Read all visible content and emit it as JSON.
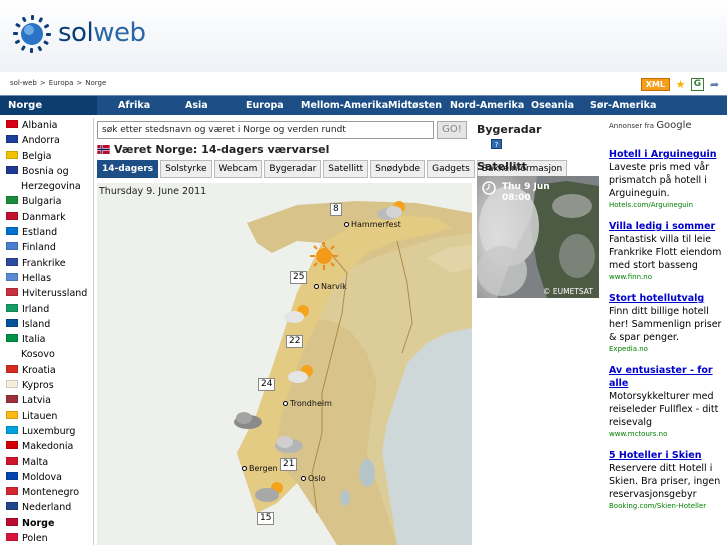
{
  "header": {
    "logo_sol": "sol",
    "logo_web": "web"
  },
  "breadcrumb": [
    "sol-web",
    ">",
    "Europa",
    ">",
    "Norge"
  ],
  "toolbar": {
    "xml_label": "XML"
  },
  "nav": {
    "current": "Norge",
    "items": [
      "Afrika",
      "Asia",
      "Europa",
      "Mellom-Amerika",
      "Midtøsten",
      "Nord-Amerika",
      "Oseania",
      "Sør-Amerika"
    ]
  },
  "sidebar": {
    "countries": [
      {
        "name": "Albania",
        "flag": "#d90012"
      },
      {
        "name": "Andorra",
        "flag": "#1e3f99"
      },
      {
        "name": "Belgia",
        "flag": "#f2c200"
      },
      {
        "name": "Bosnia og",
        "flag": "#1f3a93"
      },
      {
        "name": "Herzegovina",
        "flag": ""
      },
      {
        "name": "Bulgaria",
        "flag": "#1c8a3c"
      },
      {
        "name": "Danmark",
        "flag": "#c8102e"
      },
      {
        "name": "Estland",
        "flag": "#0072ce"
      },
      {
        "name": "Finland",
        "flag": "#4a7fcf"
      },
      {
        "name": "Frankrike",
        "flag": "#2c4ba0"
      },
      {
        "name": "Hellas",
        "flag": "#5a8ad6"
      },
      {
        "name": "Hviterussland",
        "flag": "#c8313e"
      },
      {
        "name": "Irland",
        "flag": "#169b62"
      },
      {
        "name": "Island",
        "flag": "#02529c"
      },
      {
        "name": "Italia",
        "flag": "#009246"
      },
      {
        "name": "Kosovo",
        "flag": ""
      },
      {
        "name": "Kroatia",
        "flag": "#d52b1e"
      },
      {
        "name": "Kypros",
        "flag": "#f5efdc"
      },
      {
        "name": "Latvia",
        "flag": "#9e3039"
      },
      {
        "name": "Litauen",
        "flag": "#fdb913"
      },
      {
        "name": "Luxemburg",
        "flag": "#00a1de"
      },
      {
        "name": "Makedonia",
        "flag": "#d20000"
      },
      {
        "name": "Malta",
        "flag": "#cf142b"
      },
      {
        "name": "Moldova",
        "flag": "#0046ae"
      },
      {
        "name": "Montenegro",
        "flag": "#d3272f"
      },
      {
        "name": "Nederland",
        "flag": "#21468b"
      },
      {
        "name": "Norge",
        "flag": "#ba0c2f"
      },
      {
        "name": "Polen",
        "flag": "#dc143c"
      }
    ],
    "current": "Norge"
  },
  "search": {
    "value": "søk etter stedsnavn og været i Norge og verden rundt",
    "button": "GO!"
  },
  "page_title": "Været Norge: 14-dagers værvarsel",
  "tabs": [
    "14-dagers",
    "Solstyrke",
    "Webcam",
    "Bygeradar",
    "Satellitt",
    "Snødybde",
    "Gadgets",
    "Bakkeinformasjon"
  ],
  "map": {
    "date": "Thursday  9. June 2011",
    "temps": [
      "8",
      "25",
      "22",
      "24",
      "21",
      "15"
    ],
    "cities": [
      "Hammerfest",
      "Narvik",
      "Trondheim",
      "Bergen",
      "Oslo"
    ]
  },
  "radar": {
    "title": "Bygeradar",
    "help": "?",
    "sat_title": "Satellitt",
    "sat_date_line1": "Thu  9 Jun",
    "sat_date_line2": "08:00",
    "sat_credit": "© EUMETSAT"
  },
  "ads": {
    "label": "Annonser fra",
    "label_brand": "Google",
    "items": [
      {
        "title": "Hotell i Arguineguin",
        "body": "Laveste pris med vår prismatch på hotell i Arguineguin.",
        "url": "Hotels.com/Arguineguin"
      },
      {
        "title": "Villa ledig i sommer",
        "body": "Fantastisk villa til leie Frankrike Flott eiendom med stort basseng",
        "url": "www.finn.no"
      },
      {
        "title": "Stort hotellutvalg",
        "body": "Finn ditt billige hotell her! Sammenlign priser & spar penger.",
        "url": "Expedia.no"
      },
      {
        "title": "Av entusiaster - for alle",
        "body": "Motorsykkelturer med reiseleder Fullflex - ditt reisevalg",
        "url": "www.mctours.no"
      },
      {
        "title": "5 Hoteller i Skien",
        "body": "Reservere ditt Hotell i Skien. Bra priser, ingen reservasjonsgebyr",
        "url": "Booking.com/Skien-Hoteller"
      }
    ]
  }
}
